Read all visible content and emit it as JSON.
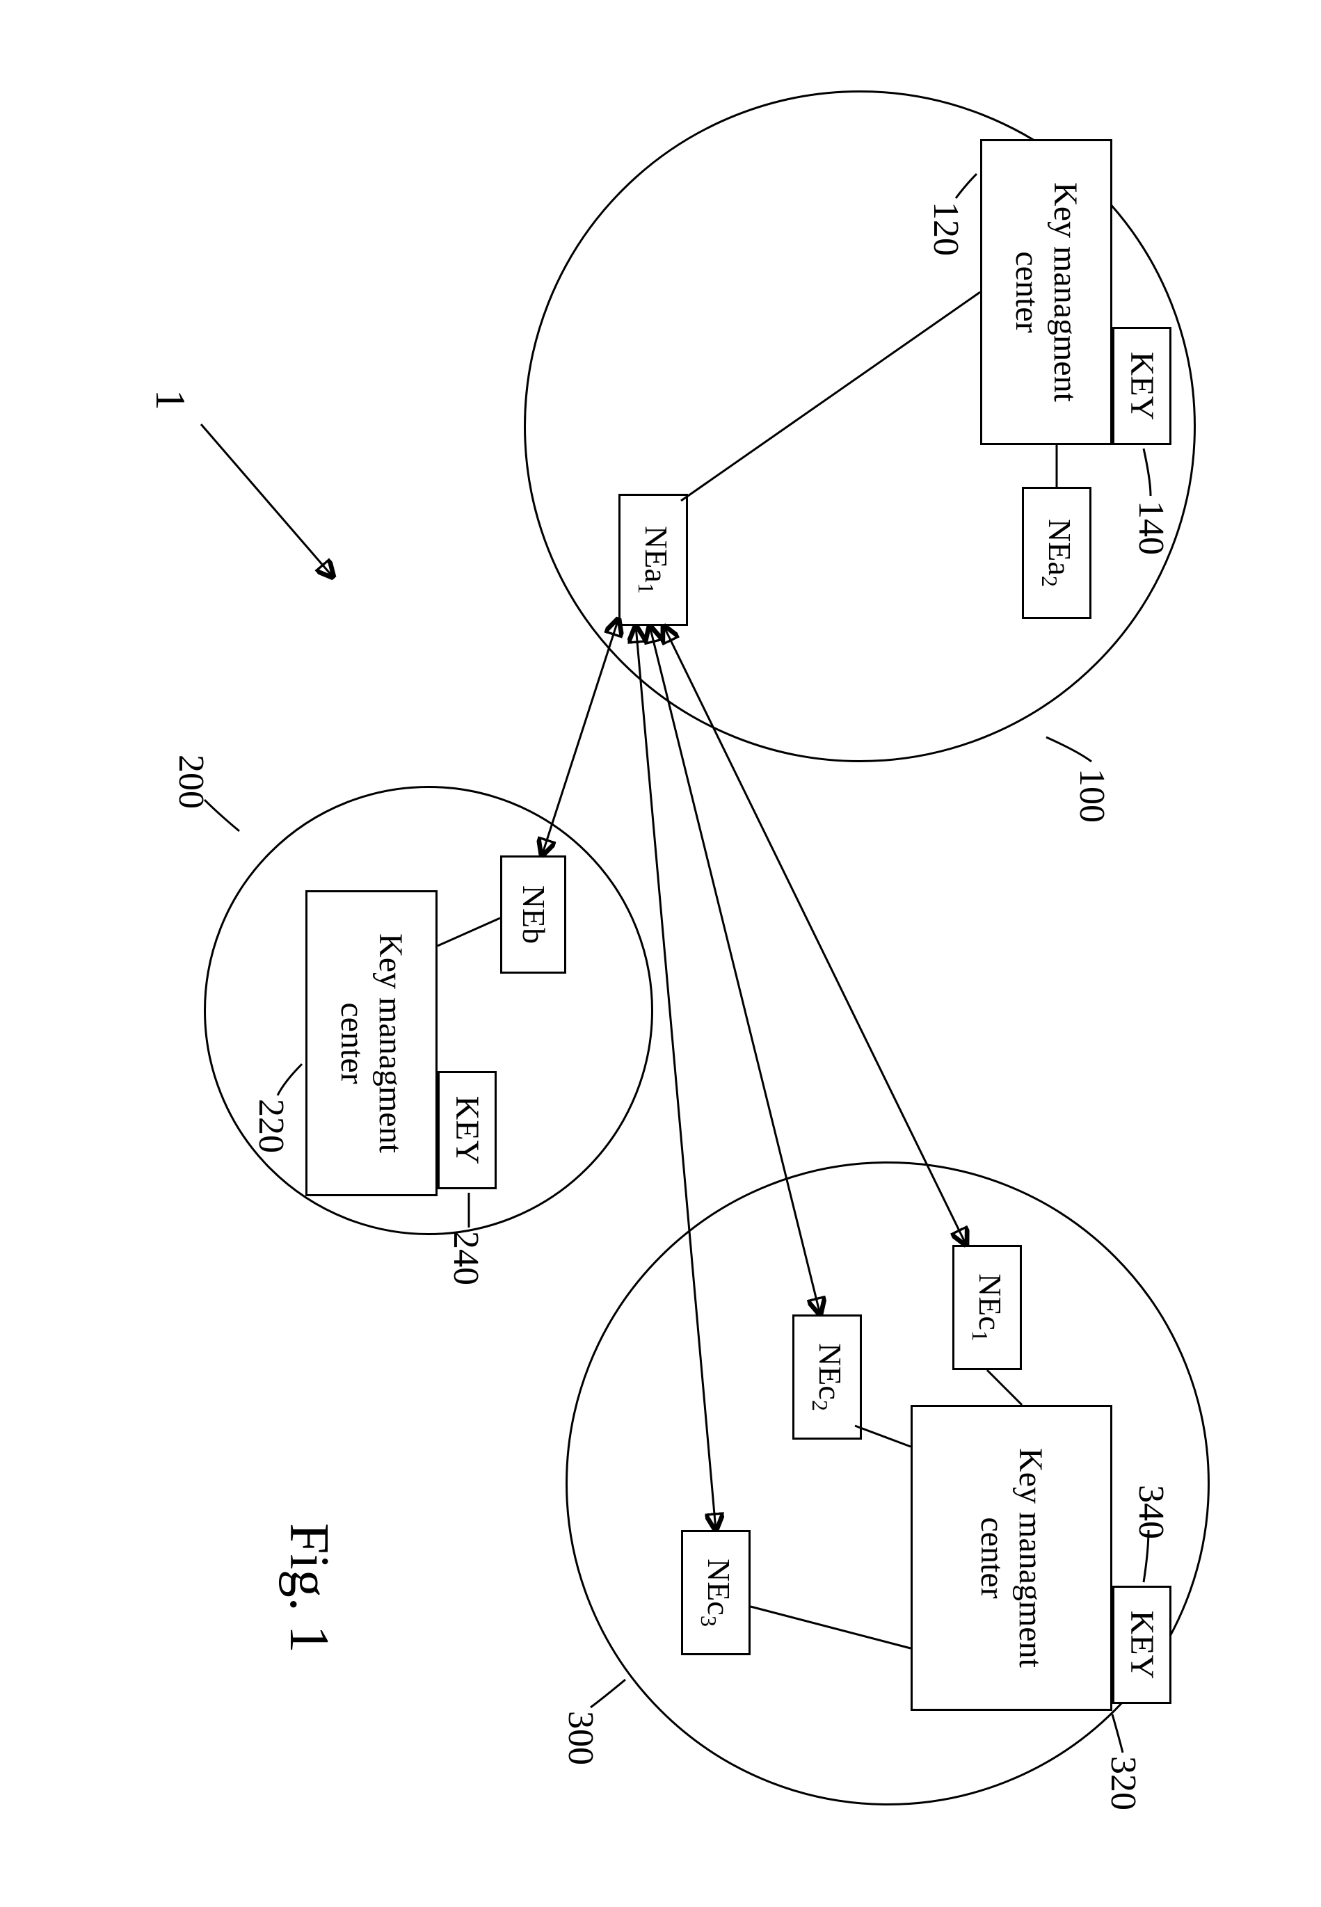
{
  "figure_label": "Fig. 1",
  "ref_arrow_label": "1",
  "domain_a": {
    "ref": "100",
    "kmc": {
      "ref": "120",
      "label": "Key managment center"
    },
    "key": {
      "ref": "140",
      "label": "KEY"
    },
    "nodes": {
      "nea1": "NEa",
      "nea1_sub": "1",
      "nea2": "NEa",
      "nea2_sub": "2"
    }
  },
  "domain_b": {
    "ref": "200",
    "kmc": {
      "ref": "220",
      "label": "Key managment center"
    },
    "key": {
      "ref": "240",
      "label": "KEY"
    },
    "nodes": {
      "neb": "NEb"
    }
  },
  "domain_c": {
    "ref": "300",
    "kmc": {
      "ref": "320",
      "label": "Key managment center"
    },
    "key": {
      "ref": "340",
      "label": "KEY"
    },
    "nodes": {
      "nec1": "NEc",
      "nec1_sub": "1",
      "nec2": "NEc",
      "nec2_sub": "2",
      "nec3": "NEc",
      "nec3_sub": "3"
    }
  }
}
